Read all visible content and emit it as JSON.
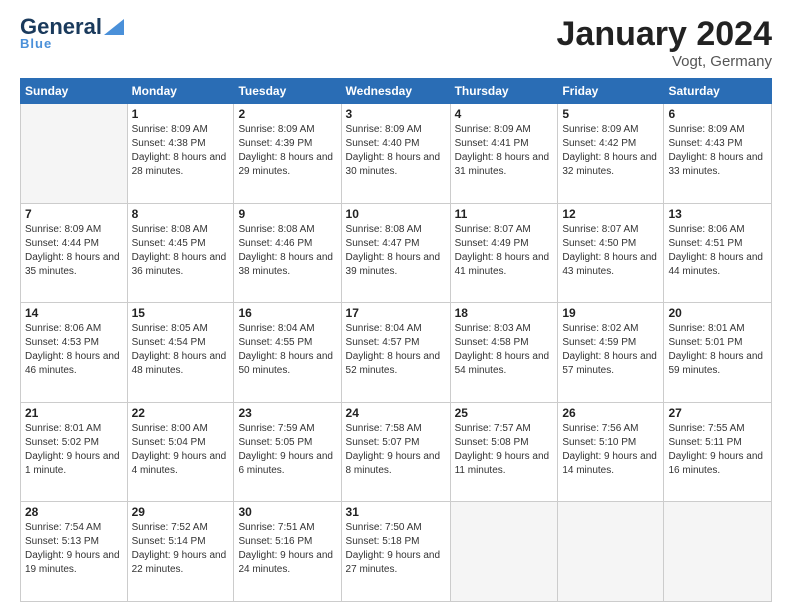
{
  "logo": {
    "general": "General",
    "blue": "Blue"
  },
  "header": {
    "month": "January 2024",
    "location": "Vogt, Germany"
  },
  "weekdays": [
    "Sunday",
    "Monday",
    "Tuesday",
    "Wednesday",
    "Thursday",
    "Friday",
    "Saturday"
  ],
  "weeks": [
    [
      {
        "day": "",
        "sunrise": "",
        "sunset": "",
        "daylight": "",
        "empty": true
      },
      {
        "day": "1",
        "sunrise": "Sunrise: 8:09 AM",
        "sunset": "Sunset: 4:38 PM",
        "daylight": "Daylight: 8 hours and 28 minutes."
      },
      {
        "day": "2",
        "sunrise": "Sunrise: 8:09 AM",
        "sunset": "Sunset: 4:39 PM",
        "daylight": "Daylight: 8 hours and 29 minutes."
      },
      {
        "day": "3",
        "sunrise": "Sunrise: 8:09 AM",
        "sunset": "Sunset: 4:40 PM",
        "daylight": "Daylight: 8 hours and 30 minutes."
      },
      {
        "day": "4",
        "sunrise": "Sunrise: 8:09 AM",
        "sunset": "Sunset: 4:41 PM",
        "daylight": "Daylight: 8 hours and 31 minutes."
      },
      {
        "day": "5",
        "sunrise": "Sunrise: 8:09 AM",
        "sunset": "Sunset: 4:42 PM",
        "daylight": "Daylight: 8 hours and 32 minutes."
      },
      {
        "day": "6",
        "sunrise": "Sunrise: 8:09 AM",
        "sunset": "Sunset: 4:43 PM",
        "daylight": "Daylight: 8 hours and 33 minutes."
      }
    ],
    [
      {
        "day": "7",
        "sunrise": "Sunrise: 8:09 AM",
        "sunset": "Sunset: 4:44 PM",
        "daylight": "Daylight: 8 hours and 35 minutes."
      },
      {
        "day": "8",
        "sunrise": "Sunrise: 8:08 AM",
        "sunset": "Sunset: 4:45 PM",
        "daylight": "Daylight: 8 hours and 36 minutes."
      },
      {
        "day": "9",
        "sunrise": "Sunrise: 8:08 AM",
        "sunset": "Sunset: 4:46 PM",
        "daylight": "Daylight: 8 hours and 38 minutes."
      },
      {
        "day": "10",
        "sunrise": "Sunrise: 8:08 AM",
        "sunset": "Sunset: 4:47 PM",
        "daylight": "Daylight: 8 hours and 39 minutes."
      },
      {
        "day": "11",
        "sunrise": "Sunrise: 8:07 AM",
        "sunset": "Sunset: 4:49 PM",
        "daylight": "Daylight: 8 hours and 41 minutes."
      },
      {
        "day": "12",
        "sunrise": "Sunrise: 8:07 AM",
        "sunset": "Sunset: 4:50 PM",
        "daylight": "Daylight: 8 hours and 43 minutes."
      },
      {
        "day": "13",
        "sunrise": "Sunrise: 8:06 AM",
        "sunset": "Sunset: 4:51 PM",
        "daylight": "Daylight: 8 hours and 44 minutes."
      }
    ],
    [
      {
        "day": "14",
        "sunrise": "Sunrise: 8:06 AM",
        "sunset": "Sunset: 4:53 PM",
        "daylight": "Daylight: 8 hours and 46 minutes."
      },
      {
        "day": "15",
        "sunrise": "Sunrise: 8:05 AM",
        "sunset": "Sunset: 4:54 PM",
        "daylight": "Daylight: 8 hours and 48 minutes."
      },
      {
        "day": "16",
        "sunrise": "Sunrise: 8:04 AM",
        "sunset": "Sunset: 4:55 PM",
        "daylight": "Daylight: 8 hours and 50 minutes."
      },
      {
        "day": "17",
        "sunrise": "Sunrise: 8:04 AM",
        "sunset": "Sunset: 4:57 PM",
        "daylight": "Daylight: 8 hours and 52 minutes."
      },
      {
        "day": "18",
        "sunrise": "Sunrise: 8:03 AM",
        "sunset": "Sunset: 4:58 PM",
        "daylight": "Daylight: 8 hours and 54 minutes."
      },
      {
        "day": "19",
        "sunrise": "Sunrise: 8:02 AM",
        "sunset": "Sunset: 4:59 PM",
        "daylight": "Daylight: 8 hours and 57 minutes."
      },
      {
        "day": "20",
        "sunrise": "Sunrise: 8:01 AM",
        "sunset": "Sunset: 5:01 PM",
        "daylight": "Daylight: 8 hours and 59 minutes."
      }
    ],
    [
      {
        "day": "21",
        "sunrise": "Sunrise: 8:01 AM",
        "sunset": "Sunset: 5:02 PM",
        "daylight": "Daylight: 9 hours and 1 minute."
      },
      {
        "day": "22",
        "sunrise": "Sunrise: 8:00 AM",
        "sunset": "Sunset: 5:04 PM",
        "daylight": "Daylight: 9 hours and 4 minutes."
      },
      {
        "day": "23",
        "sunrise": "Sunrise: 7:59 AM",
        "sunset": "Sunset: 5:05 PM",
        "daylight": "Daylight: 9 hours and 6 minutes."
      },
      {
        "day": "24",
        "sunrise": "Sunrise: 7:58 AM",
        "sunset": "Sunset: 5:07 PM",
        "daylight": "Daylight: 9 hours and 8 minutes."
      },
      {
        "day": "25",
        "sunrise": "Sunrise: 7:57 AM",
        "sunset": "Sunset: 5:08 PM",
        "daylight": "Daylight: 9 hours and 11 minutes."
      },
      {
        "day": "26",
        "sunrise": "Sunrise: 7:56 AM",
        "sunset": "Sunset: 5:10 PM",
        "daylight": "Daylight: 9 hours and 14 minutes."
      },
      {
        "day": "27",
        "sunrise": "Sunrise: 7:55 AM",
        "sunset": "Sunset: 5:11 PM",
        "daylight": "Daylight: 9 hours and 16 minutes."
      }
    ],
    [
      {
        "day": "28",
        "sunrise": "Sunrise: 7:54 AM",
        "sunset": "Sunset: 5:13 PM",
        "daylight": "Daylight: 9 hours and 19 minutes."
      },
      {
        "day": "29",
        "sunrise": "Sunrise: 7:52 AM",
        "sunset": "Sunset: 5:14 PM",
        "daylight": "Daylight: 9 hours and 22 minutes."
      },
      {
        "day": "30",
        "sunrise": "Sunrise: 7:51 AM",
        "sunset": "Sunset: 5:16 PM",
        "daylight": "Daylight: 9 hours and 24 minutes."
      },
      {
        "day": "31",
        "sunrise": "Sunrise: 7:50 AM",
        "sunset": "Sunset: 5:18 PM",
        "daylight": "Daylight: 9 hours and 27 minutes."
      },
      {
        "day": "",
        "sunrise": "",
        "sunset": "",
        "daylight": "",
        "empty": true
      },
      {
        "day": "",
        "sunrise": "",
        "sunset": "",
        "daylight": "",
        "empty": true
      },
      {
        "day": "",
        "sunrise": "",
        "sunset": "",
        "daylight": "",
        "empty": true
      }
    ]
  ]
}
